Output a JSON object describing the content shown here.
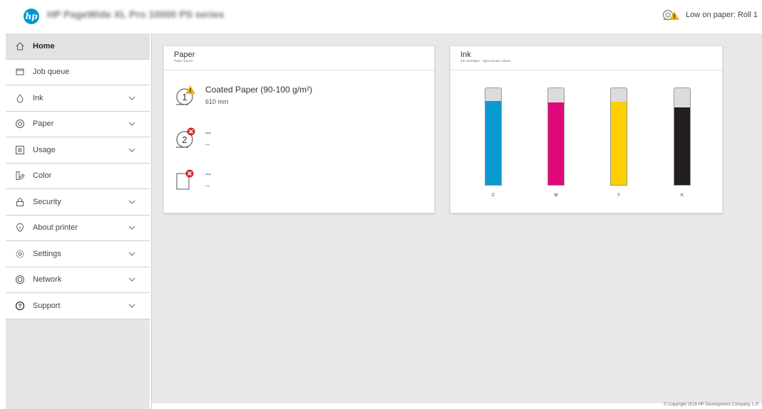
{
  "header": {
    "logo_text": "hp",
    "title": "HP PageWide XL Pro 10000 PS series",
    "alert_text": "Low on paper: Roll 1",
    "alert_icon": "roll-warning-icon"
  },
  "sidebar": {
    "items": [
      {
        "label": "Home",
        "icon": "home-icon",
        "active": true,
        "expandable": false
      },
      {
        "label": "Job queue",
        "icon": "queue-icon",
        "active": false,
        "expandable": false
      },
      {
        "label": "Ink",
        "icon": "ink-drop-icon",
        "active": false,
        "expandable": true
      },
      {
        "label": "Paper",
        "icon": "paper-roll-icon",
        "active": false,
        "expandable": true
      },
      {
        "label": "Usage",
        "icon": "usage-icon",
        "active": false,
        "expandable": true
      },
      {
        "label": "Color",
        "icon": "color-swatch-icon",
        "active": false,
        "expandable": false
      },
      {
        "label": "Security",
        "icon": "lock-icon",
        "active": false,
        "expandable": true
      },
      {
        "label": "About printer",
        "icon": "info-icon",
        "active": false,
        "expandable": true
      },
      {
        "label": "Settings",
        "icon": "gear-icon",
        "active": false,
        "expandable": true
      },
      {
        "label": "Network",
        "icon": "network-icon",
        "active": false,
        "expandable": true
      },
      {
        "label": "Support",
        "icon": "help-icon",
        "active": false,
        "expandable": true
      }
    ]
  },
  "paper_card": {
    "title": "Paper",
    "subtitle": "Paper source",
    "sources": [
      {
        "number": "1",
        "name": "Coated Paper (90-100 g/m²)",
        "detail": "610 mm",
        "status": "warning",
        "kind": "roll"
      },
      {
        "number": "2",
        "name": "--",
        "detail": "--",
        "status": "error",
        "kind": "roll"
      },
      {
        "number": "",
        "name": "--",
        "detail": "--",
        "status": "error",
        "kind": "sheet"
      }
    ]
  },
  "ink_card": {
    "title": "Ink",
    "subtitle": "Ink cartridges - Approximate values",
    "cartridges": [
      {
        "label": "C",
        "level": 0.87,
        "color": "#0a9ad0"
      },
      {
        "label": "M",
        "level": 0.85,
        "color": "#e0097a"
      },
      {
        "label": "Y",
        "level": 0.86,
        "color": "#fdd000"
      },
      {
        "label": "K",
        "level": 0.8,
        "color": "#231f20"
      }
    ]
  },
  "footer": {
    "copyright": "© Copyright 2018 HP Development Company, L.P."
  },
  "colors": {
    "hp_blue": "#0096d6",
    "warning": "#f4b400",
    "error": "#d9262c"
  }
}
